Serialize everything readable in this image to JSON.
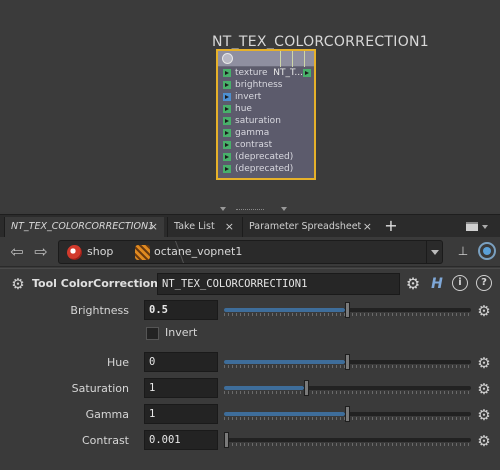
{
  "network": {
    "node_title": "NT_TEX_COLORCORRECTION1",
    "node_rows": [
      {
        "label": "texture",
        "value": "NT_T...",
        "port": "green"
      },
      {
        "label": "brightness",
        "value": "",
        "port": "green"
      },
      {
        "label": "invert",
        "value": "",
        "port": "blue"
      },
      {
        "label": "hue",
        "value": "",
        "port": "green"
      },
      {
        "label": "saturation",
        "value": "",
        "port": "green"
      },
      {
        "label": "gamma",
        "value": "",
        "port": "green"
      },
      {
        "label": "contrast",
        "value": "",
        "port": "green"
      },
      {
        "label": "(deprecated)",
        "value": "",
        "port": "green"
      },
      {
        "label": "(deprecated)",
        "value": "",
        "port": "green"
      }
    ],
    "selection_color": "#e6b12a"
  },
  "tabs": [
    {
      "label": "NT_TEX_COLORCORRECTION1",
      "active": true
    },
    {
      "label": "Take List",
      "active": false
    },
    {
      "label": "Parameter Spreadsheet",
      "active": false
    }
  ],
  "tab_close_glyph": "×",
  "tab_add_glyph": "+",
  "path": {
    "crumbs": [
      {
        "label": "shop",
        "icon": "shop-icon"
      },
      {
        "label": "octane_vopnet1",
        "icon": "octane-icon"
      }
    ]
  },
  "param_header": {
    "tool_label": "Tool ColorCorrection",
    "node_name": "NT_TEX_COLORCORRECTION1",
    "help_glyph": "?",
    "info_glyph": "i"
  },
  "params": {
    "brightness": {
      "label": "Brightness",
      "value": "0.5",
      "slider_fraction": 0.5
    },
    "invert": {
      "label": "Invert",
      "checked": false
    },
    "hue": {
      "label": "Hue",
      "value": "0",
      "slider_fraction": 0.5
    },
    "saturation": {
      "label": "Saturation",
      "value": "1",
      "slider_fraction": 0.33
    },
    "gamma": {
      "label": "Gamma",
      "value": "1",
      "slider_fraction": 0.5
    },
    "contrast": {
      "label": "Contrast",
      "value": "0.001",
      "slider_fraction": 0.0
    }
  },
  "colors": {
    "accent": "#3e6d9a",
    "background": "#3a3a3a"
  }
}
